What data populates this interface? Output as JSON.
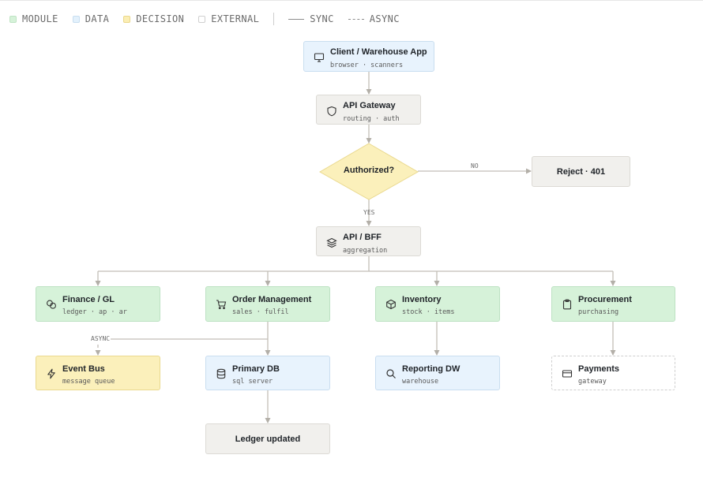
{
  "legend": {
    "module": "MODULE",
    "data": "DATA",
    "decision": "DECISION",
    "external": "EXTERNAL",
    "sync": "SYNC",
    "async": "ASYNC"
  },
  "nodes": {
    "client": {
      "title": "Client / Warehouse App",
      "sub": "browser · scanners",
      "icon": "monitor-icon"
    },
    "gateway": {
      "title": "API Gateway",
      "sub": "routing · auth",
      "icon": "shield-icon"
    },
    "decision": {
      "title": "Authorized?"
    },
    "reject": {
      "title": "Reject · 401"
    },
    "bff": {
      "title": "API / BFF",
      "sub": "aggregation",
      "icon": "layers-icon"
    },
    "finance": {
      "title": "Finance / GL",
      "sub": "ledger · ap · ar",
      "icon": "coins-icon"
    },
    "orders": {
      "title": "Order Management",
      "sub": "sales · fulfil",
      "icon": "cart-icon"
    },
    "inventory": {
      "title": "Inventory",
      "sub": "stock · items",
      "icon": "box-icon"
    },
    "procurement": {
      "title": "Procurement",
      "sub": "purchasing",
      "icon": "clipboard-icon"
    },
    "eventbus": {
      "title": "Event Bus",
      "sub": "message queue",
      "icon": "bolt-icon"
    },
    "primarydb": {
      "title": "Primary DB",
      "sub": "sql server",
      "icon": "database-icon"
    },
    "reporting": {
      "title": "Reporting DW",
      "sub": "warehouse",
      "icon": "search-icon"
    },
    "payments": {
      "title": "Payments",
      "sub": "gateway",
      "icon": "card-icon"
    },
    "ledger": {
      "title": "Ledger updated"
    }
  },
  "edge_labels": {
    "no": "NO",
    "yes": "YES",
    "async": "ASYNC"
  }
}
